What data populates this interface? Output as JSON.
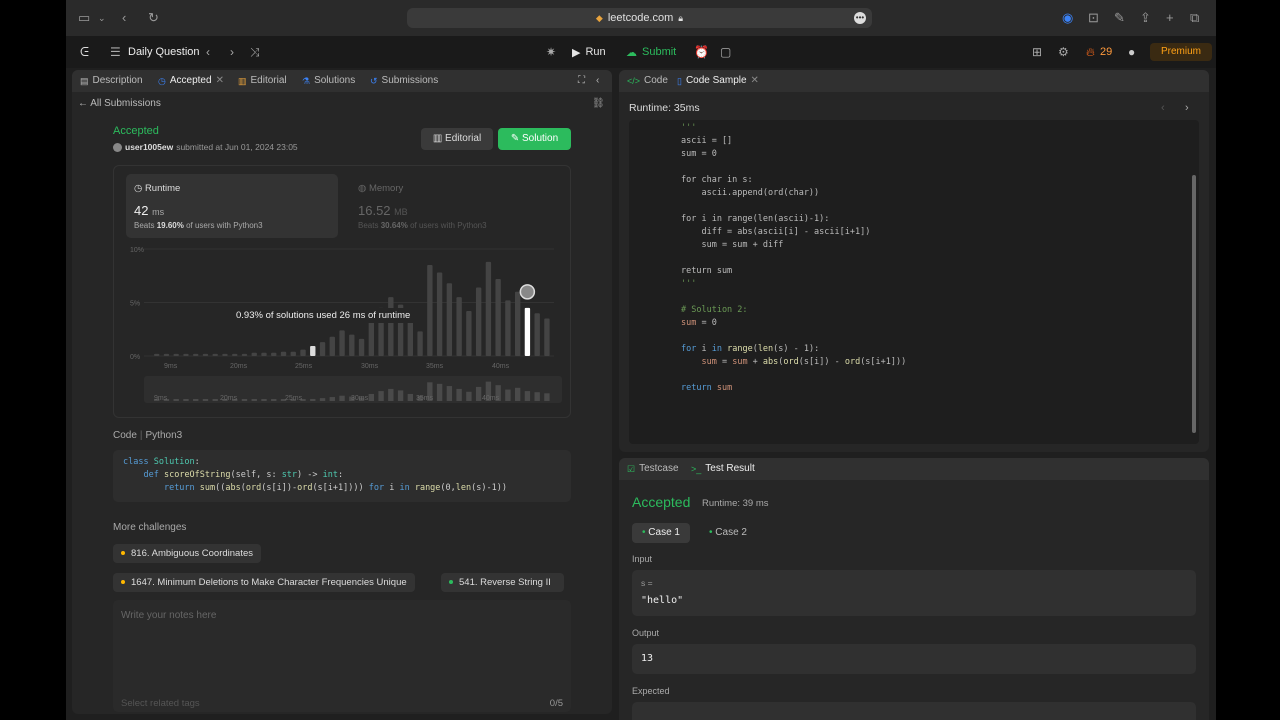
{
  "browser": {
    "url": "leetcode.com"
  },
  "nav": {
    "title": "Daily Question",
    "run": "Run",
    "submit": "Submit",
    "streak": "29",
    "premium": "Premium"
  },
  "left_tabs": {
    "description": "Description",
    "accepted": "Accepted",
    "editorial": "Editorial",
    "solutions": "Solutions",
    "submissions": "Submissions"
  },
  "all_submissions": "All Submissions",
  "result": {
    "status": "Accepted",
    "user": "user1005ew",
    "submitted": "submitted at Jun 01, 2024 23:05",
    "editorial_btn": "Editorial",
    "solution_btn": "Solution"
  },
  "runtime": {
    "label": "Runtime",
    "value": "42",
    "unit": "ms",
    "beats_prefix": "Beats",
    "beats": "19.60%",
    "beats_suffix": "of users with Python3"
  },
  "memory": {
    "label": "Memory",
    "value": "16.52",
    "unit": "MB",
    "beats_prefix": "Beats",
    "beats": "30.64%",
    "beats_suffix": "of users with Python3"
  },
  "tooltip": "0.93% of solutions used 26 ms of runtime",
  "chart_data": {
    "type": "bar",
    "y_ticks": [
      "10%",
      "5%",
      "0%"
    ],
    "x_ticks": [
      "9ms",
      "20ms",
      "25ms",
      "30ms",
      "35ms",
      "40ms"
    ],
    "ylim": [
      0,
      10
    ],
    "values": [
      0.2,
      0.2,
      0.2,
      0.2,
      0.2,
      0.2,
      0.2,
      0.2,
      0.2,
      0.2,
      0.3,
      0.3,
      0.3,
      0.4,
      0.4,
      0.6,
      0.93,
      1.3,
      1.8,
      2.4,
      2.0,
      1.6,
      3.2,
      4.5,
      5.5,
      4.8,
      3.2,
      2.3,
      8.5,
      7.8,
      6.8,
      5.5,
      4.2,
      6.4,
      8.8,
      7.2,
      5.2,
      6.0,
      4.5,
      4.0,
      3.5
    ],
    "highlight_index": 38,
    "mini_values": [
      0.2,
      0.2,
      0.2,
      0.2,
      0.2,
      0.2,
      0.2,
      0.2,
      0.2,
      0.2,
      0.3,
      0.3,
      0.3,
      0.4,
      0.4,
      0.6,
      0.93,
      1.3,
      1.8,
      2.4,
      2.0,
      1.6,
      3.2,
      4.5,
      5.5,
      4.8,
      3.2,
      2.3,
      8.5,
      7.8,
      6.8,
      5.5,
      4.2,
      6.4,
      8.8,
      7.2,
      5.2,
      6.0,
      4.5,
      4.0,
      3.5
    ]
  },
  "code": {
    "label": "Code",
    "lang": "Python3"
  },
  "more": {
    "label": "More challenges",
    "items": [
      "816. Ambiguous Coordinates",
      "1647. Minimum Deletions to Make Character Frequencies Unique",
      "541. Reverse String II"
    ]
  },
  "notes": {
    "placeholder": "Write your notes here",
    "tags": "Select related tags",
    "count": "0/5"
  },
  "right_tabs": {
    "code": "Code",
    "sample": "Code Sample"
  },
  "sample_runtime": "Runtime: 35ms",
  "bottom_tabs": {
    "testcase": "Testcase",
    "result": "Test Result"
  },
  "test": {
    "status": "Accepted",
    "runtime": "Runtime: 39 ms",
    "case1": "Case 1",
    "case2": "Case 2",
    "input_label": "Input",
    "input_key": "s =",
    "input_value": "\"hello\"",
    "output_label": "Output",
    "output_value": "13",
    "expected_label": "Expected"
  },
  "colors": {
    "accent": "#2cbb5d",
    "premium": "#ffa116",
    "bar": "#444444",
    "highlight": "#ffffff"
  }
}
